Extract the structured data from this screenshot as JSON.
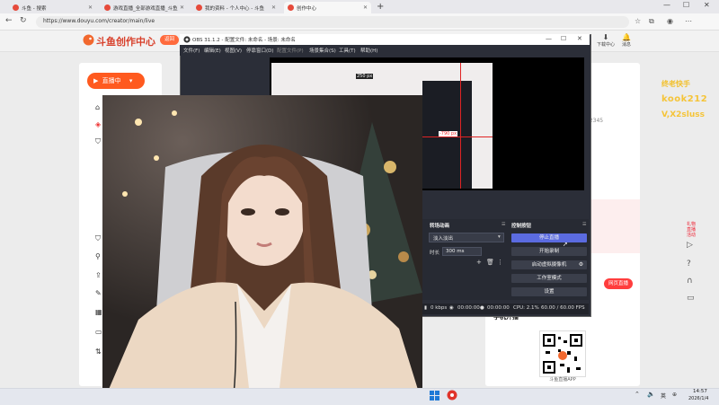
{
  "browser": {
    "tabs": [
      {
        "label": "斗鱼 - 搜索",
        "active": false
      },
      {
        "label": "游戏直播_全部游戏直播_斗鱼直播",
        "active": false
      },
      {
        "label": "我的资料 - 个人中心 - 斗鱼",
        "active": false
      },
      {
        "label": "创作中心",
        "active": true
      }
    ],
    "url": "https://www.douyu.com/creator/main/live"
  },
  "douyu": {
    "logo_text": "斗鱼创作中心",
    "back_button": "返回",
    "live_button": "直播中",
    "header_icons": [
      {
        "glyph": "⬇",
        "label": "下载中心"
      },
      {
        "glyph": "🔔",
        "label": "消息"
      }
    ],
    "number_fragment": "02345",
    "web_live_button": "网页直播",
    "mobile_live_title": "手机开播",
    "qr_caption": "斗鱼直播APP",
    "side_red_text": "礼物 直播 活动"
  },
  "obs": {
    "title": "OBS 31.1.2 - 配置文件: 未命名 - 场景: 未命名",
    "menu": [
      "文件(F)",
      "编辑(E)",
      "视图(V)",
      "停靠窗口(D)",
      "配置文件(P)",
      "场景集合(S)",
      "工具(T)",
      "帮助(H)"
    ],
    "preview_fragment": "250 px",
    "preview_fragment2": "-790 px",
    "transition_title": "转场动画",
    "transition_value": "淡入淡出",
    "duration_label": "时长",
    "duration_value": "300 ms",
    "controls_title": "控制按钮",
    "controls": [
      {
        "label": "停止直播",
        "accent": "#5b6be0"
      },
      {
        "label": "开始录制"
      },
      {
        "label": "启动虚拟摄像机"
      },
      {
        "label": "工作室模式"
      },
      {
        "label": "设置"
      }
    ],
    "status": {
      "bitrate": "0 kbps",
      "stream_time": "00:00:00",
      "rec_time": "00:00:00",
      "cpu": "CPU: 2.1%",
      "fps": "60.00 / 60.00 FPS"
    }
  },
  "overlay": {
    "line1": "终老快手",
    "line2": "kook212",
    "line3": "V,X2sluss"
  },
  "taskbar": {
    "lang": "英",
    "time": "14:57",
    "date": "2026/1/4"
  }
}
